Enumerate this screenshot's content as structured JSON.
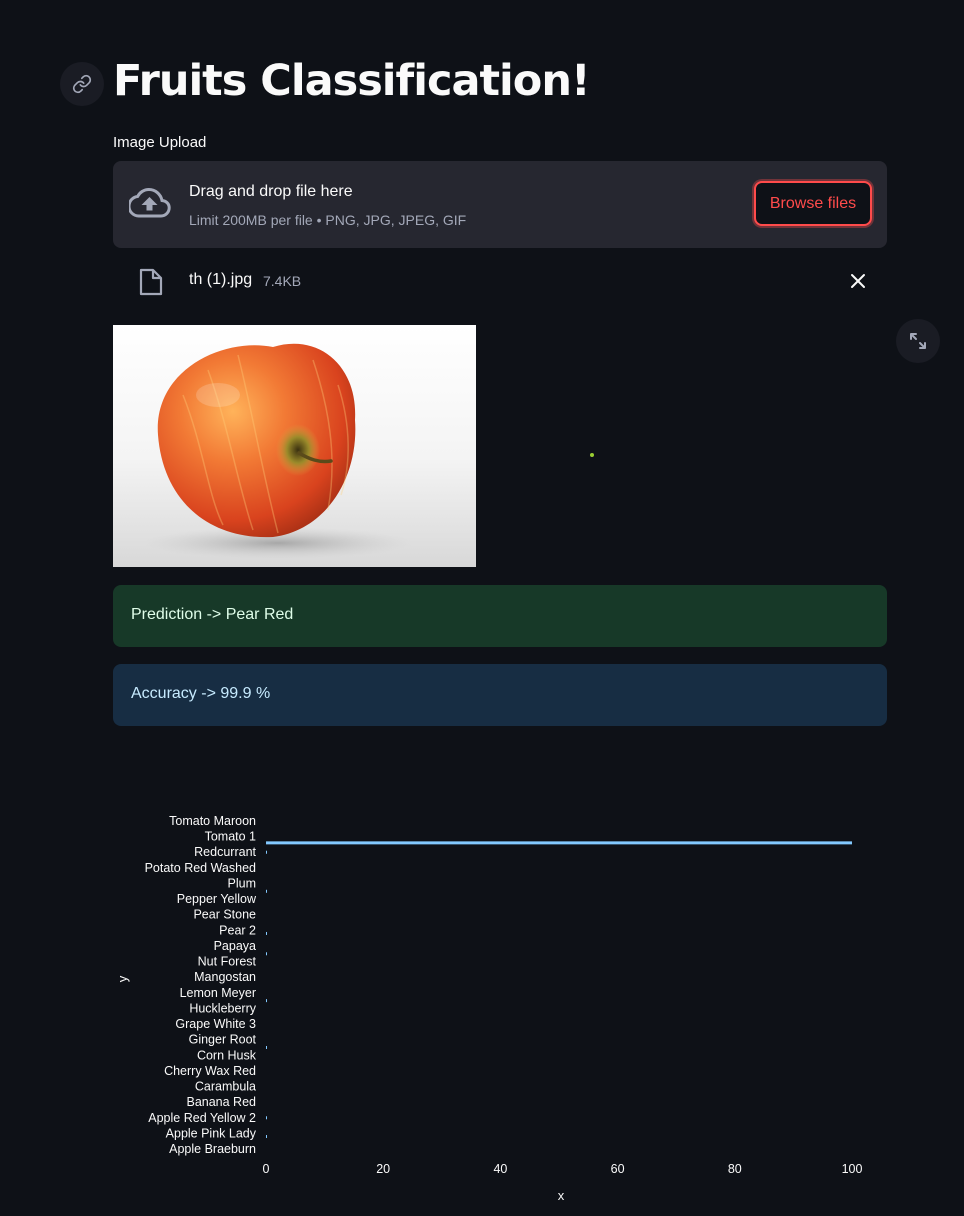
{
  "header": {
    "title": "Fruits Classification!",
    "anchor_icon": "link-icon"
  },
  "uploader": {
    "label": "Image Upload",
    "drop_text": "Drag and drop file here",
    "limit_text": "Limit 200MB per file • PNG, JPG, JPEG, GIF",
    "browse_label": "Browse files",
    "cloud_icon": "cloud-upload-icon"
  },
  "file": {
    "name": "th (1).jpg",
    "size": "7.4KB",
    "icon": "file-icon",
    "close_icon": "close-icon"
  },
  "image": {
    "subject": "apple",
    "expand_icon": "fullscreen-icon"
  },
  "results": {
    "prediction": "Prediction -> Pear Red",
    "accuracy": "Accuracy -> 99.9 %"
  },
  "colors": {
    "background": "#0e1117",
    "primary": "#ff4b4b",
    "success_bg": "#173928",
    "info_bg": "#172d43",
    "bar": "#83c9ff"
  },
  "chart_data": {
    "type": "bar",
    "orientation": "horizontal",
    "xlabel": "x",
    "ylabel": "y",
    "xlim": [
      0,
      100
    ],
    "x_ticks": [
      0,
      20,
      40,
      60,
      80,
      100
    ],
    "y_tick_labels": [
      "Apple Braeburn",
      "Apple Pink Lady",
      "Apple Red Yellow 2",
      "Banana Red",
      "Carambula",
      "Cherry Wax Red",
      "Corn Husk",
      "Ginger Root",
      "Grape White 3",
      "Huckleberry",
      "Lemon Meyer",
      "Mangostan",
      "Nut Forest",
      "Papaya",
      "Pear 2",
      "Pear Stone",
      "Pepper Yellow",
      "Plum",
      "Potato Red Washed",
      "Redcurrant",
      "Tomato 1",
      "Tomato Maroon"
    ],
    "bars": [
      {
        "position": 6.5,
        "value": 0.1
      },
      {
        "position": 9.5,
        "value": 0.1
      },
      {
        "position": 12.5,
        "value": 0.1
      },
      {
        "position": 13.8,
        "value": 0.1
      },
      {
        "position": 16.5,
        "value": 0.1
      },
      {
        "position": 19.0,
        "value": 0.1
      },
      {
        "position": 19.6,
        "value": 100
      },
      {
        "position": 23.6,
        "value": 0.1
      },
      {
        "position": 0.8,
        "value": 0.05
      },
      {
        "position": 2.0,
        "value": 0.05
      }
    ],
    "grid": false
  }
}
